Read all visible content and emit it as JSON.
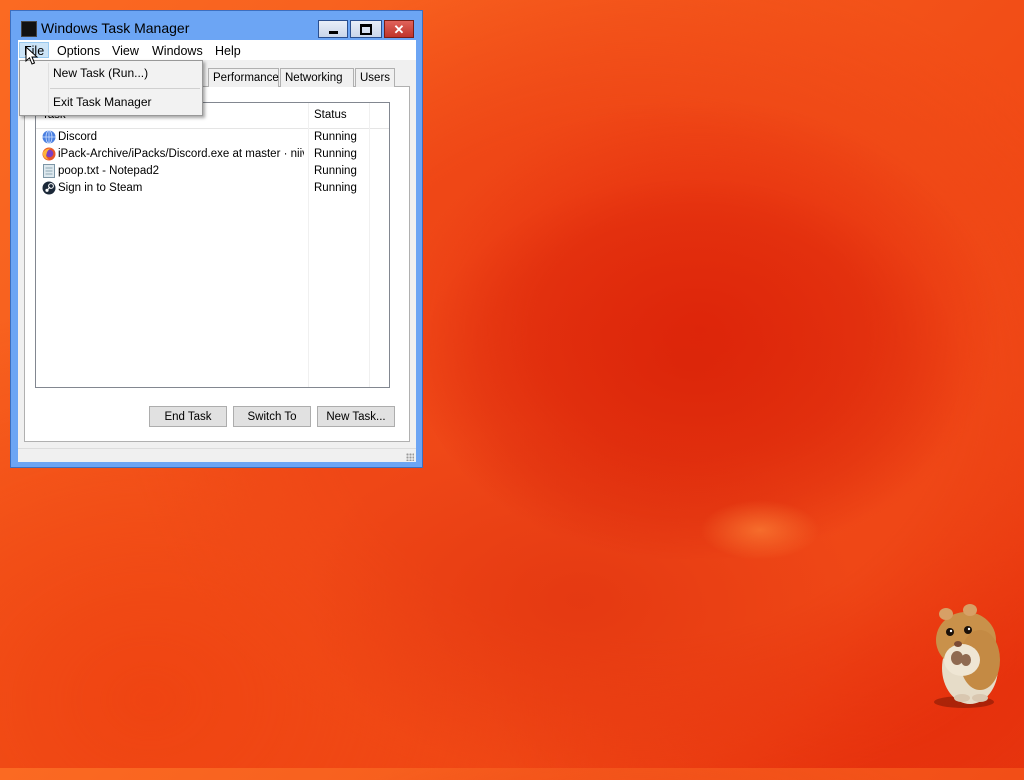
{
  "window": {
    "title": "Windows Task Manager",
    "close_glyph": "✕"
  },
  "menubar": {
    "items": [
      "File",
      "Options",
      "View",
      "Windows",
      "Help"
    ]
  },
  "file_menu": {
    "items": [
      "New Task (Run...)",
      "Exit Task Manager"
    ]
  },
  "tabs": [
    "Performance",
    "Networking",
    "Users"
  ],
  "task_list": {
    "columns": [
      "Task",
      "Status"
    ],
    "rows": [
      {
        "task": "Discord",
        "status": "Running",
        "icon": "globe-icon",
        "icon_color": "#4a7fe0"
      },
      {
        "task": "iPack-Archive/iPacks/Discord.exe at master · niiv...",
        "status": "Running",
        "icon": "firefox-icon",
        "icon_color": "#e8572a"
      },
      {
        "task": "poop.txt - Notepad2",
        "status": "Running",
        "icon": "notepad-icon",
        "icon_color": "#9fb8c8"
      },
      {
        "task": "Sign in to Steam",
        "status": "Running",
        "icon": "steam-icon",
        "icon_color": "#1b2838"
      }
    ]
  },
  "buttons": {
    "end_task": "End Task",
    "switch_to": "Switch To",
    "new_task": "New Task..."
  },
  "colors": {
    "title_bar": "#6ca5f4",
    "close_button": "#c0352b",
    "desktop": "#f14a15"
  }
}
